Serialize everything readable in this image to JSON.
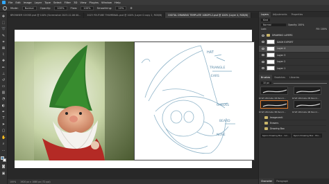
{
  "menu": {
    "items": [
      "File",
      "Edit",
      "Image",
      "Layer",
      "Type",
      "Select",
      "Filter",
      "3D",
      "View",
      "Plugins",
      "Window",
      "Help"
    ]
  },
  "options": {
    "mode_label": "Mode:",
    "mode_value": "Normal",
    "opacity_label": "Opacity:",
    "opacity_value": "100%",
    "flow_label": "Flow:",
    "flow_value": "100%",
    "smoothing_label": "Smoothing:",
    "smoothing_value": "10%"
  },
  "tabs": [
    {
      "label": "BROWNER GOOSE.psd @ 100% (Screenshot 2023-12-06 00...",
      "active": false
    },
    {
      "label": "2023 YOUTUBE THUMBNAIL.psd @ 100% (Layer 0 copy 2, RGB/8)",
      "active": false
    },
    {
      "label": "DIGITAL DRAWING TEMPLATE 1080P5-2.psd @ 100% (Layer 4, RGB/8)",
      "active": true
    }
  ],
  "sketch_notes": [
    "HAT",
    "TRIANGLE",
    "EARS",
    "CHEEKS",
    "BEARD",
    "NOSE"
  ],
  "status": {
    "zoom": "100%",
    "doc_size": "1920 px x 1080 px (72 ppi)"
  },
  "layers_panel": {
    "tabs": [
      "Layers",
      "Adjustments",
      "Properties"
    ],
    "kind_label": "Kind",
    "blend_mode": "Normal",
    "opacity_label": "Opacity: 100%",
    "lock_label": "Lock:",
    "fill_label": "Fill: 100%",
    "layers": [
      {
        "name": "DRAWING LAYERS",
        "type": "group",
        "selected": false
      },
      {
        "name": "DASH EXPORT",
        "type": "layer",
        "selected": false
      },
      {
        "name": "Layer 4",
        "type": "layer",
        "selected": true
      },
      {
        "name": "Layer 3",
        "type": "layer",
        "selected": false
      },
      {
        "name": "Layer 2",
        "type": "layer",
        "selected": false
      },
      {
        "name": "Layer 1",
        "type": "layer",
        "selected": false
      }
    ]
  },
  "brushes_panel": {
    "tabs": [
      "Brushes",
      "Swatches",
      "Libraries"
    ],
    "size_value": "10 px",
    "brushes": [
      {
        "label": "KYLE Ultimate 1B Pencil..."
      },
      {
        "label": "KYLE Ultimate 2B Pencil..."
      },
      {
        "label": "KYLE Ultimate 3B Pencil..."
      },
      {
        "label": "KYLE Ultimate 4B Pencil..."
      }
    ],
    "groups": [
      "Imagecenti",
      "Erasers",
      "Drawing Box"
    ],
    "bottom_items": [
      "Kyle's Drawing Box - Gri...",
      "Kyle's Drawing Box - Pro..."
    ]
  },
  "bottom_tabs": [
    "Character",
    "Paragraph"
  ]
}
